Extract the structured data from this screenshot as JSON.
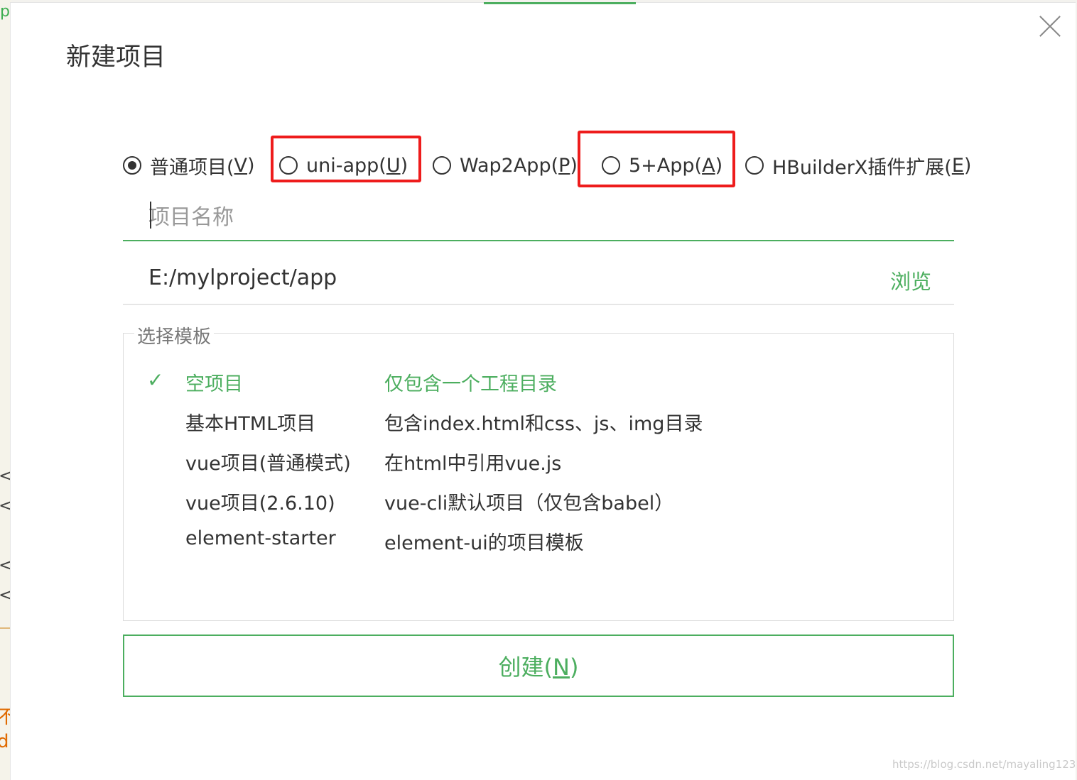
{
  "background": {
    "top_fragment": "po",
    "chevrons": [
      "<",
      "<",
      "<",
      "<"
    ],
    "orange_fragments": [
      "不",
      "d"
    ]
  },
  "dialog": {
    "title": "新建项目",
    "close_label": "×"
  },
  "project_types": [
    {
      "label": "普通项目(",
      "hotkey": "V",
      "suffix": ")",
      "checked": true
    },
    {
      "label": "uni-app(",
      "hotkey": "U",
      "suffix": ")",
      "checked": false
    },
    {
      "label": "Wap2App(",
      "hotkey": "P",
      "suffix": ")",
      "checked": false
    },
    {
      "label": "5+App(",
      "hotkey": "A",
      "suffix": ")",
      "checked": false
    },
    {
      "label": "HBuilderX插件扩展(",
      "hotkey": "E",
      "suffix": ")",
      "checked": false
    }
  ],
  "project_name": {
    "value": "",
    "placeholder": "项目名称"
  },
  "location": {
    "path": "E:/mylproject/app",
    "browse_label": "浏览"
  },
  "templates": {
    "legend": "选择模板",
    "check_mark": "✓",
    "items": [
      {
        "name": "空项目",
        "desc": "仅包含一个工程目录",
        "selected": true
      },
      {
        "name": "基本HTML项目",
        "desc": "包含index.html和css、js、img目录",
        "selected": false
      },
      {
        "name": "vue项目(普通模式)",
        "desc": "在html中引用vue.js",
        "selected": false
      },
      {
        "name": "vue项目(2.6.10)",
        "desc": "vue-cli默认项目（仅包含babel）",
        "selected": false
      },
      {
        "name": "element-starter",
        "desc": "element-ui的项目模板",
        "selected": false
      }
    ]
  },
  "create_button": {
    "label": "创建(",
    "hotkey": "N",
    "suffix": ")"
  },
  "watermark": "https://blog.csdn.net/mayaling123",
  "colors": {
    "accent": "#4cae5f",
    "highlight": "#ee1c1c",
    "text": "#333333"
  }
}
